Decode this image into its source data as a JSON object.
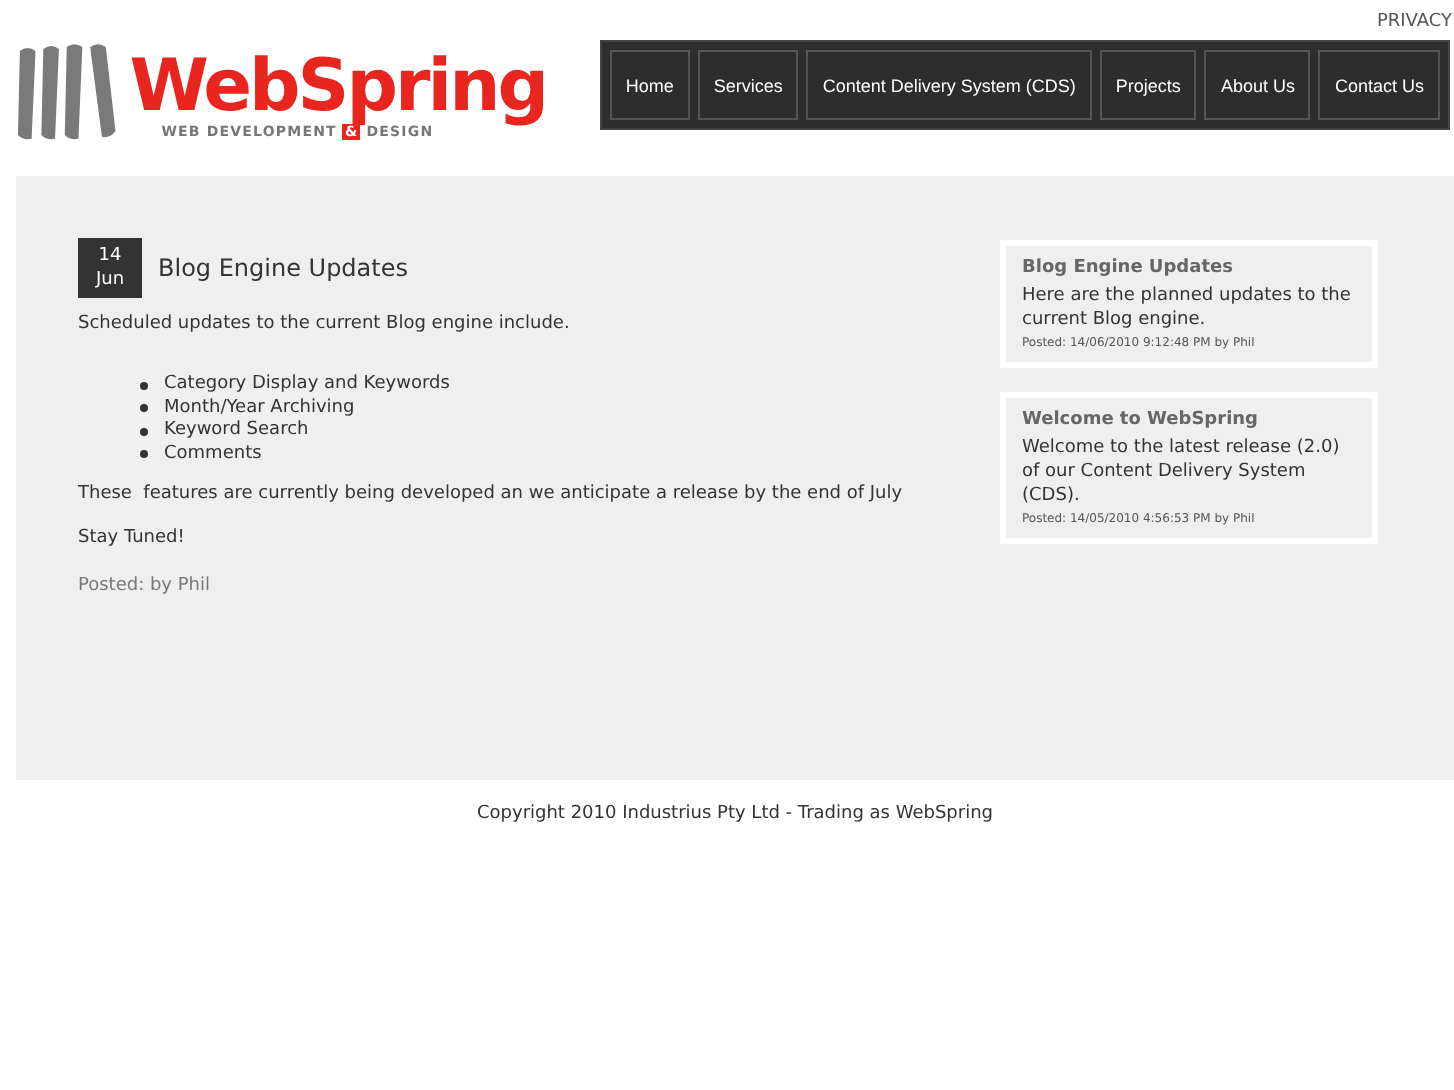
{
  "top_link": "PRIVACY",
  "logo": {
    "name": "WebSpring",
    "tagline": [
      {
        "text": "WEB DEVELOPMENT ",
        "kind": "plain"
      },
      {
        "text": "&",
        "kind": "mark"
      },
      {
        "text": " DESIGN",
        "kind": "plain"
      }
    ]
  },
  "nav": [
    "Home",
    "Services",
    "Content Delivery System (CDS)",
    "Projects",
    "About Us",
    "Contact Us"
  ],
  "post": {
    "day": "14",
    "month": "Jun",
    "title": "Blog Engine Updates",
    "intro": "Scheduled updates to the current Blog engine include.",
    "bullets": [
      "Category Display and Keywords",
      "Month/Year Archiving",
      "Keyword Search",
      "Comments"
    ],
    "paragraphs": [
      "These  features are currently being developed an we anticipate a release by the end of July",
      "Stay Tuned!"
    ],
    "meta": "Posted: by Phil"
  },
  "sidebar": [
    {
      "title": "Blog Engine Updates",
      "summary": "Here are the planned updates to the current Blog engine.",
      "meta": "Posted: 14/06/2010 9:12:48 PM by Phil"
    },
    {
      "title": "Welcome to WebSpring",
      "summary": "Welcome to the latest release (2.0) of our Content Delivery System (CDS).",
      "meta": "Posted: 14/05/2010 4:56:53 PM by Phil"
    }
  ],
  "footer": "Copyright 2010 Industrius Pty Ltd - Trading as WebSpring"
}
